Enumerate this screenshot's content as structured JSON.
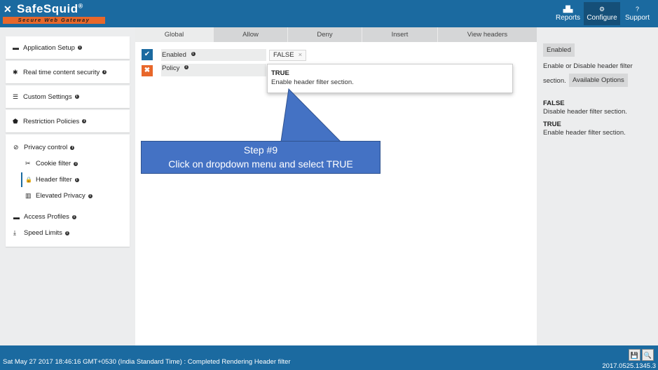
{
  "header": {
    "logo_name": "SafeSquid",
    "logo_reg": "®",
    "logo_tagline": "Secure Web Gateway",
    "nav": [
      {
        "label": "Reports",
        "icon": "reports-icon",
        "glyph": "▟▙"
      },
      {
        "label": "Configure",
        "icon": "configure-icon",
        "glyph": "⚙"
      },
      {
        "label": "Support",
        "icon": "help-icon",
        "glyph": "?"
      }
    ]
  },
  "sidebar": {
    "items": [
      {
        "label": "Application Setup",
        "icon": "briefcase-icon",
        "glyph": "▬"
      },
      {
        "label": "Real time content security",
        "icon": "bug-icon",
        "glyph": "✱"
      },
      {
        "label": "Custom Settings",
        "icon": "sliders-icon",
        "glyph": "☰"
      },
      {
        "label": "Restriction Policies",
        "icon": "shield-icon",
        "glyph": "⬟"
      }
    ],
    "privacy": {
      "label": "Privacy control",
      "glyph": "⊘",
      "children": [
        {
          "label": "Cookie filter",
          "glyph": "✂"
        },
        {
          "label": "Header filter",
          "glyph": "🔒"
        },
        {
          "label": "Elevated Privacy",
          "glyph": "▥"
        }
      ]
    },
    "bottom_items": [
      {
        "label": "Access Profiles",
        "glyph": "▬"
      },
      {
        "label": "Speed Limits",
        "glyph": "⤓"
      }
    ],
    "info_glyph": "i"
  },
  "tabs": [
    "Global",
    "Allow",
    "Deny",
    "Insert",
    "View headers"
  ],
  "form": {
    "enabled_label": "Enabled",
    "policy_label": "Policy",
    "enabled_check": "✔",
    "policy_check": "✖",
    "enabled_value": "FALSE",
    "clear_glyph": "×"
  },
  "dropdown": {
    "option_title": "TRUE",
    "option_desc": "Enable header filter section."
  },
  "callout": {
    "line1": "Step #9",
    "line2": "Click on dropdown menu and select TRUE"
  },
  "right_panel": {
    "enabled_btn": "Enabled",
    "desc_line1": "Enable or Disable header filter",
    "desc_line2": "section.",
    "available_btn": "Available Options",
    "options": [
      {
        "title": "FALSE",
        "desc": "Disable header filter section."
      },
      {
        "title": "TRUE",
        "desc": "Enable header filter section."
      }
    ]
  },
  "status": {
    "text": "Sat May 27 2017 18:46:16 GMT+0530 (India Standard Time) : Completed Rendering Header filter",
    "version": "2017.0525.1345.3",
    "save_glyph": "💾",
    "search_glyph": "🔍"
  },
  "colors": {
    "primary": "#1b6aa0",
    "accent": "#e8672a",
    "callout": "#4472c4"
  }
}
